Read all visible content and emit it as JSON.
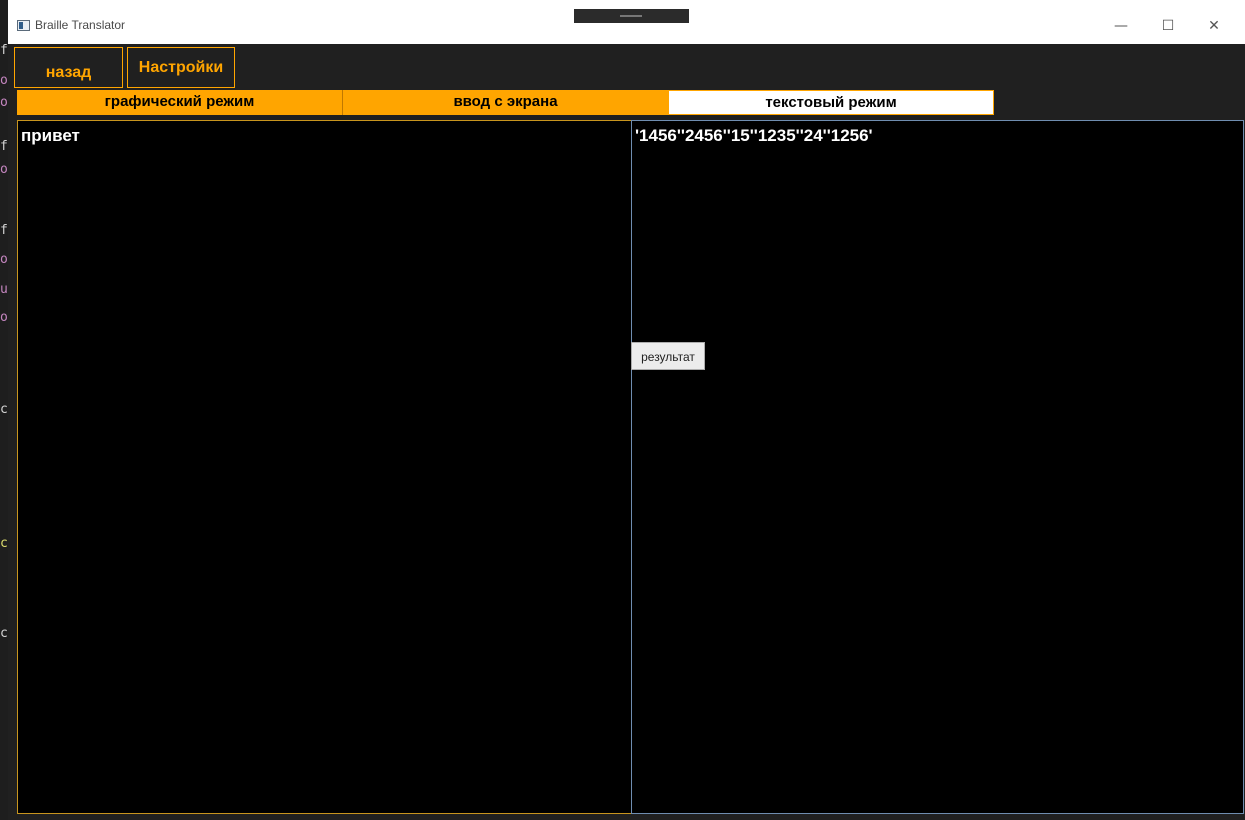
{
  "window": {
    "title": "Braille Translator",
    "controls": {
      "minimize_icon": "—",
      "maximize_icon": "☐",
      "close_icon": "✕"
    }
  },
  "nav": {
    "back_label": "назад",
    "settings_label": "Настройки"
  },
  "modes": [
    {
      "label": "графический режим",
      "active": false
    },
    {
      "label": "ввод с экрана",
      "active": false
    },
    {
      "label": "текстовый режим",
      "active": true
    }
  ],
  "input_text": "привет",
  "output_text": "'1456''2456''15''1235''24''1256'",
  "result_button_label": "результат",
  "colors": {
    "accent": "#ffa500",
    "window_bg": "#202020",
    "pane_bg": "#000000",
    "active_tab_bg": "#ffffff",
    "editor_glyph_purple": "#c586c0",
    "editor_glyph_yellow": "#dcdc6e",
    "editor_glyph_white": "#d4d4d4"
  }
}
